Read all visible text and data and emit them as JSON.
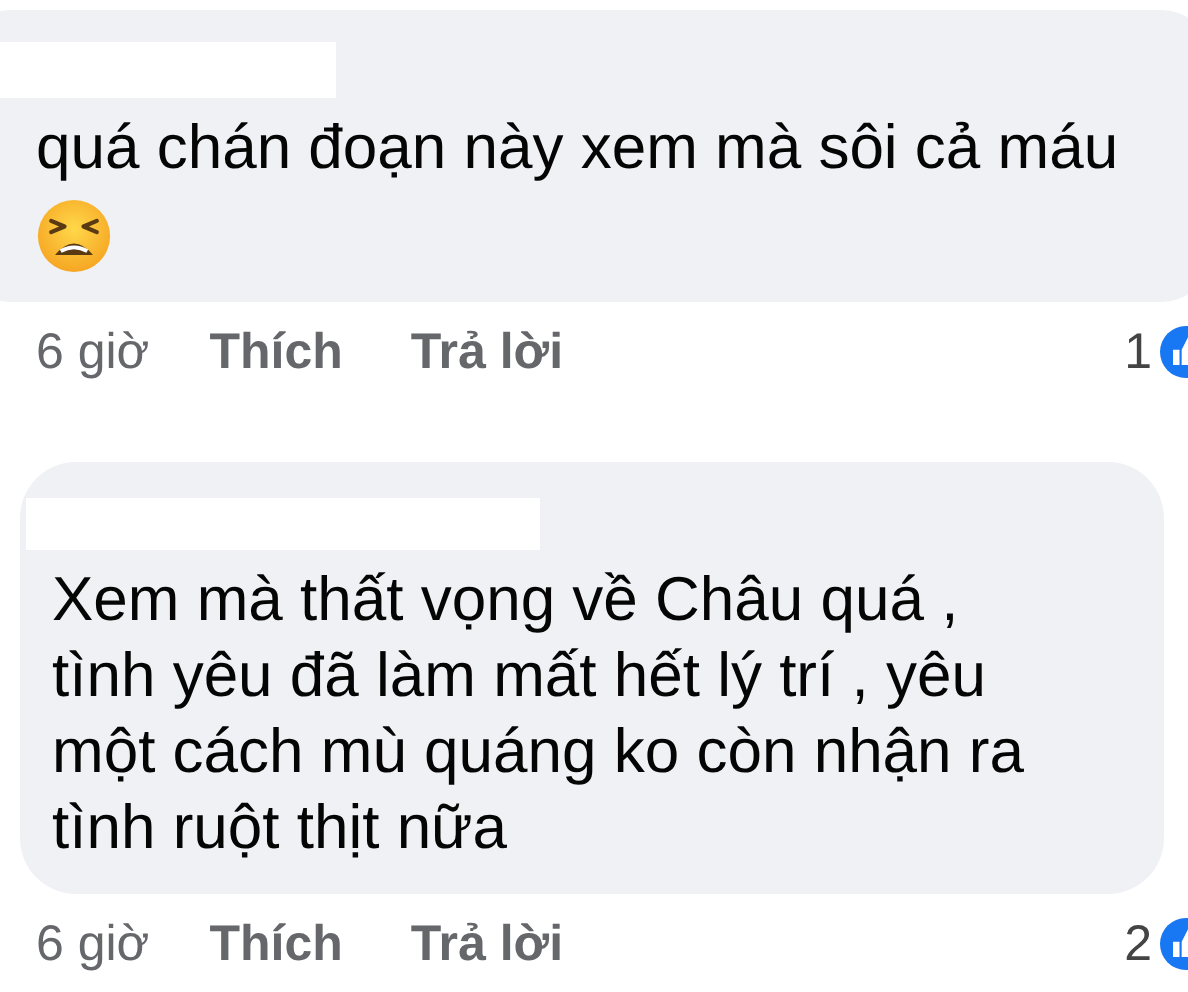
{
  "comments": [
    {
      "name_redacted": true,
      "text": "quá chán đoạn này xem mà sôi cả máu",
      "has_emoji": true,
      "time": "6 giờ",
      "like_label": "Thích",
      "reply_label": "Trả lời",
      "reaction_count": "1"
    },
    {
      "name_redacted": true,
      "text": "Xem mà thất vọng về Châu quá , tình yêu đã làm mất hết lý trí , yêu một cách mù quáng ko còn nhận ra tình ruột thịt nữa",
      "time": "6 giờ",
      "like_label": "Thích",
      "reply_label": "Trả lời",
      "reaction_count": "2"
    }
  ]
}
